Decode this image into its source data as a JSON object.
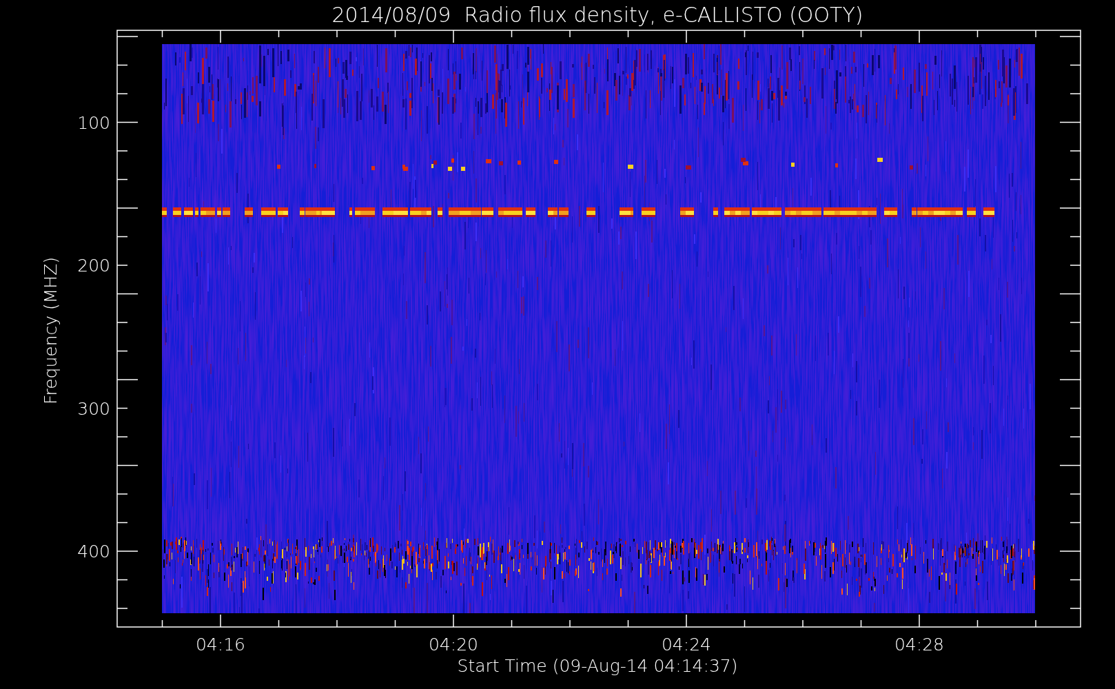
{
  "chart": {
    "title": "2014/08/09  Radio flux density, e-CALLISTO (OOTY)",
    "ylabel": "Frequency (MHZ)",
    "xlabel": "Start Time (09-Aug-14 04:14:37)",
    "yticks": [
      "100",
      "200",
      "300",
      "400"
    ],
    "xticks": [
      "04:16",
      "04:20",
      "04:24",
      "04:28"
    ]
  }
}
